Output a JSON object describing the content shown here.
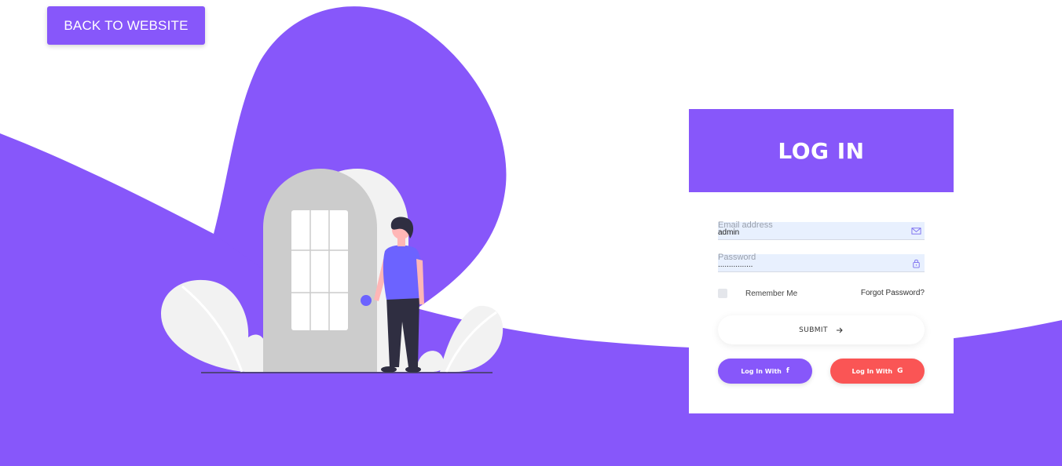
{
  "header": {
    "back_label": "BACK TO WEBSITE"
  },
  "login": {
    "title": "LOG IN",
    "email_placeholder": "Email address",
    "email_value": "admin",
    "password_placeholder": "Password",
    "password_value": "................",
    "remember_label": "Remember Me",
    "forgot_label": "Forgot Password?",
    "submit_label": "SUBMIT",
    "facebook_label": "Log In With",
    "facebook_icon_glyph": "f",
    "google_label": "Log In With",
    "google_icon_glyph": "G"
  },
  "icons": {
    "email": "envelope-icon",
    "password": "lock-icon",
    "submit": "arrow-right-icon",
    "facebook": "facebook-icon",
    "google": "google-icon"
  },
  "colors": {
    "accent": "#8757fa",
    "google": "#fa5555",
    "input_bg": "#e8f0fe",
    "door": "#cccccc",
    "shirt": "#6c63ff",
    "skin": "#ffb6b6",
    "pants": "#2f2e41"
  }
}
